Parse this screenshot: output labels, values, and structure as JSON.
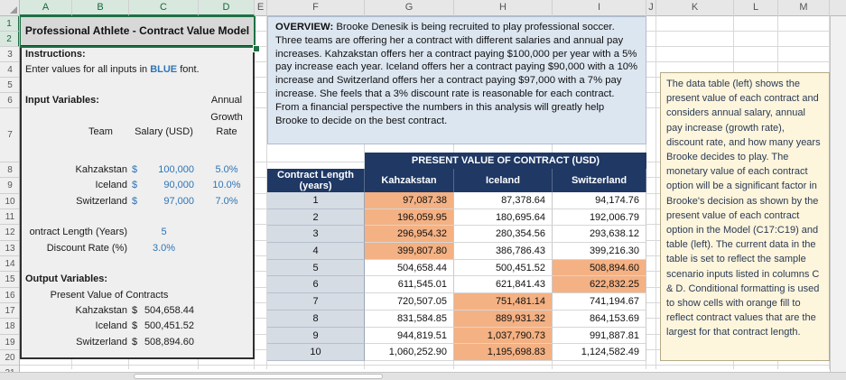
{
  "colors": {
    "accent_blue": "#2E75B6",
    "header_navy": "#1F3864",
    "highlight_orange": "#F4B183",
    "overview_bg": "#DCE6F1",
    "note_bg": "#FDF5DC",
    "selection_green": "#1E7145"
  },
  "sheet": {
    "columns": [
      "A",
      "B",
      "C",
      "D",
      "E",
      "F",
      "G",
      "H",
      "I",
      "J",
      "K",
      "L",
      "M"
    ],
    "selected_columns": [
      "A",
      "B",
      "C",
      "D"
    ],
    "rows": [
      "1",
      "2",
      "3",
      "4",
      "5",
      "6",
      "7",
      "8",
      "9",
      "10",
      "11",
      "12",
      "13",
      "14",
      "15",
      "16",
      "17",
      "18",
      "19",
      "20",
      "21"
    ],
    "selected_rows": [
      "1",
      "2"
    ]
  },
  "model": {
    "title": "Professional Athlete - Contract Value Model",
    "instructions_label": "Instructions:",
    "instructions_pre": "Enter values for all inputs in ",
    "instructions_blue": "BLUE",
    "instructions_post": " font.",
    "input_section_label": "Input Variables:",
    "annual_growth_lines": [
      "Annual",
      "Growth",
      "Rate"
    ],
    "team_header": "Team",
    "salary_header": "Salary (USD)",
    "inputs": [
      {
        "team": "Kahzakstan",
        "currency": "$",
        "salary": "100,000",
        "growth": "5.0%"
      },
      {
        "team": "Iceland",
        "currency": "$",
        "salary": "90,000",
        "growth": "10.0%"
      },
      {
        "team": "Switzerland",
        "currency": "$",
        "salary": "97,000",
        "growth": "7.0%"
      }
    ],
    "contract_length_label": "ontract Length (Years)",
    "contract_length_value": "5",
    "discount_rate_label": "Discount Rate (%)",
    "discount_rate_value": "3.0%",
    "output_section_label": "Output Variables:",
    "output_header": "Present Value of Contracts",
    "outputs": [
      {
        "team": "Kahzakstan",
        "currency": "$",
        "value": "504,658.44"
      },
      {
        "team": "Iceland",
        "currency": "$",
        "value": "500,451.52"
      },
      {
        "team": "Switzerland",
        "currency": "$",
        "value": "508,894.60"
      }
    ]
  },
  "overview": {
    "label": "OVERVIEW:",
    "text": " Brooke Denesik is being recruited to play professional soccer. Three teams are offering her a contract with different salaries and annual pay increases. Kahzakstan offers her a contract paying $100,000 per year with a 5% pay increase each year. Iceland offers her a contract paying $90,000 with a 10% increase and Switzerland offers her a contract paying $97,000 with a 7% pay increase. She feels that a 3% discount rate is reasonable for each contract. From a financial perspective the numbers in this analysis will greatly help Brooke to decide on the best contract."
  },
  "pv_table": {
    "title": "PRESENT VALUE OF CONTRACT (USD)",
    "row_header_line1": "Contract Length",
    "row_header_line2": "(years)",
    "columns": [
      "Kahzakstan",
      "Iceland",
      "Switzerland"
    ],
    "rows": [
      {
        "year": "1",
        "values": [
          "97,087.38",
          "87,378.64",
          "94,174.76"
        ]
      },
      {
        "year": "2",
        "values": [
          "196,059.95",
          "180,695.64",
          "192,006.79"
        ]
      },
      {
        "year": "3",
        "values": [
          "296,954.32",
          "280,354.56",
          "293,638.12"
        ]
      },
      {
        "year": "4",
        "values": [
          "399,807.80",
          "386,786.43",
          "399,216.30"
        ]
      },
      {
        "year": "5",
        "values": [
          "504,658.44",
          "500,451.52",
          "508,894.60"
        ]
      },
      {
        "year": "6",
        "values": [
          "611,545.01",
          "621,841.43",
          "622,832.25"
        ]
      },
      {
        "year": "7",
        "values": [
          "720,507.05",
          "751,481.14",
          "741,194.67"
        ]
      },
      {
        "year": "8",
        "values": [
          "831,584.85",
          "889,931.32",
          "864,153.69"
        ]
      },
      {
        "year": "9",
        "values": [
          "944,819.51",
          "1,037,790.73",
          "991,887.81"
        ]
      },
      {
        "year": "10",
        "values": [
          "1,060,252.90",
          "1,195,698.83",
          "1,124,582.49"
        ]
      }
    ]
  },
  "note": {
    "text": "The data table (left) shows the present value of each contract and considers annual salary, annual pay increase (growth rate), discount rate, and how many years Brooke decides to play. The monetary value of each contract option will be a significant factor in Brooke's decision as shown by the present value of each contract option in the Model (C17:C19) and table (left). The current data in the table is set to reflect the sample scenario inputs listed in columns C & D.  Conditional formatting is used to show cells with orange fill to reflect contract values that are the largest for that contract length."
  }
}
